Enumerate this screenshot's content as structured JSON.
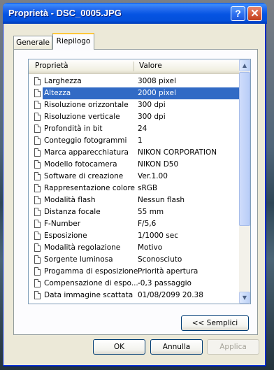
{
  "window": {
    "title": "Proprietà - DSC_0005.JPG",
    "help_glyph": "?",
    "close_glyph": "✕"
  },
  "tabs": [
    {
      "label": "Generale"
    },
    {
      "label": "Riepilogo"
    }
  ],
  "list": {
    "columns": {
      "property": "Proprietà",
      "value": "Valore"
    },
    "rows": [
      {
        "property": "Larghezza",
        "value": "3008 pixel"
      },
      {
        "property": "Altezza",
        "value": "2000 pixel",
        "selected": true
      },
      {
        "property": "Risoluzione orizzontale",
        "value": "300 dpi"
      },
      {
        "property": "Risoluzione verticale",
        "value": "300 dpi"
      },
      {
        "property": "Profondità in bit",
        "value": "24"
      },
      {
        "property": "Conteggio fotogrammi",
        "value": "1"
      },
      {
        "property": "Marca apparecchiatura",
        "value": "NIKON CORPORATION"
      },
      {
        "property": "Modello fotocamera",
        "value": "NIKON D50"
      },
      {
        "property": "Software di creazione",
        "value": "Ver.1.00"
      },
      {
        "property": "Rappresentazione colore",
        "value": "sRGB"
      },
      {
        "property": "Modalità flash",
        "value": "Nessun flash"
      },
      {
        "property": "Distanza focale",
        "value": "55 mm"
      },
      {
        "property": "F-Number",
        "value": "F/5,6"
      },
      {
        "property": "Esposizione",
        "value": "1/1000 sec"
      },
      {
        "property": "Modalità regolazione",
        "value": "Motivo"
      },
      {
        "property": "Sorgente luminosa",
        "value": "Sconosciuto"
      },
      {
        "property": "Progamma di esposizione",
        "value": "Priorità apertura"
      },
      {
        "property": "Compensazione di espo...",
        "value": "-0,3 passaggio"
      },
      {
        "property": "Data immagine scattata",
        "value": "01/08/2099 20.38"
      }
    ]
  },
  "buttons": {
    "semplici": "<< Semplici",
    "ok": "OK",
    "annulla": "Annulla",
    "applica": "Applica"
  },
  "colors": {
    "selection": "#316ac5",
    "titlebar": "#0554e3",
    "dialog_bg": "#ECE9D8"
  }
}
